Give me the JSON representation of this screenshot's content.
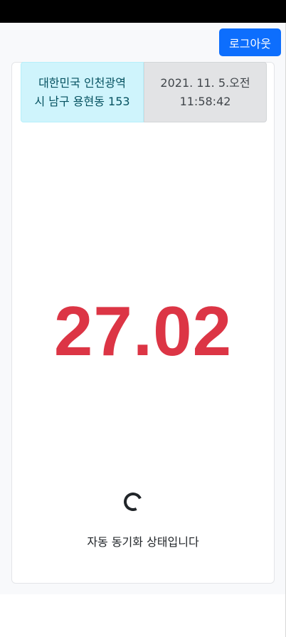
{
  "header": {
    "logout_label": "로그아웃"
  },
  "location": {
    "line1": "대한민국 인천광역",
    "line2": "시 남구 용현동 153"
  },
  "datetime": {
    "line1": "2021. 11. 5.오전",
    "line2": "11:58:42"
  },
  "reading": {
    "value": "27.02",
    "color": "#dc3545"
  },
  "status": {
    "message": "자동 동기화 상태입니다"
  }
}
